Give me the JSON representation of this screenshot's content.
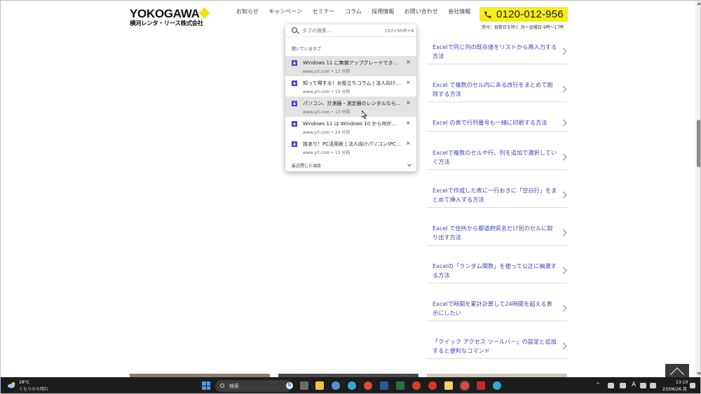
{
  "header": {
    "logo_main": "YOKOGAWA",
    "logo_sub": "横河レンタ・リース株式会社",
    "nav": [
      "お知らせ",
      "キャンペーン",
      "セミナー",
      "コラム",
      "採用情報",
      "お問い合わせ",
      "会社情報"
    ],
    "phone": "0120-012-956",
    "hours": "受付：祝祭日を除く 月～金曜日 9時～17時",
    "accent_color": "#f6ec1a"
  },
  "tab_search": {
    "placeholder": "タブの検索...",
    "shortcut": "Ctrl+Shift+A",
    "open_tabs_label": "開いているタブ",
    "tabs": [
      {
        "title": "Windows 11 に無償アップグレードできる端...",
        "meta": "www.yrl.com • 13 分前"
      },
      {
        "title": "知って得する！お役立ちコラム | 法人向けパ...",
        "meta": "www.yrl.com • 13 分前"
      },
      {
        "title": "パソコン、計測器・測定器のレンタルなら | ...",
        "meta": "www.yrl.com • 13 分前"
      },
      {
        "title": "Windows 11 は Windows 10 から何が変わる...",
        "meta": "www.yrl.com • 24 分前"
      },
      {
        "title": "技あり！PC活用術 | 法人向けパソコン(PC)・...",
        "meta": "www.yrl.com • 13 分前"
      }
    ],
    "close_glyph": "×",
    "recently_closed_label": "最近閉じた項目"
  },
  "articles": [
    "Excelで同じ列の既存値をリストから再入力する方法",
    "Excel で複数のセル内にある改行をまとめて削除する方法",
    "Excel の表で行列番号も一緒に印刷する方法",
    "Excelで複数のセルや行、列を追加で選択していく方法",
    "Excelで作成した表に一行おきに「空白行」をまとめて挿入する方法",
    "Excel で住所から都道府県名だけ別のセルに取り出す方法",
    "Excelの「ランダム関数」を使って公正に抽選する方法",
    "Excelで時間を累計計算して24時間を超える表示にしたい",
    "「クイック アクセス ツールバー」の設定と追加すると便利なコマンド"
  ],
  "taskbar": {
    "weather_temp": "28°C",
    "weather_desc": "くもりのち晴れ",
    "search_label": "検索",
    "ime": "A",
    "time": "13:10",
    "date": "23/06/26 月"
  }
}
